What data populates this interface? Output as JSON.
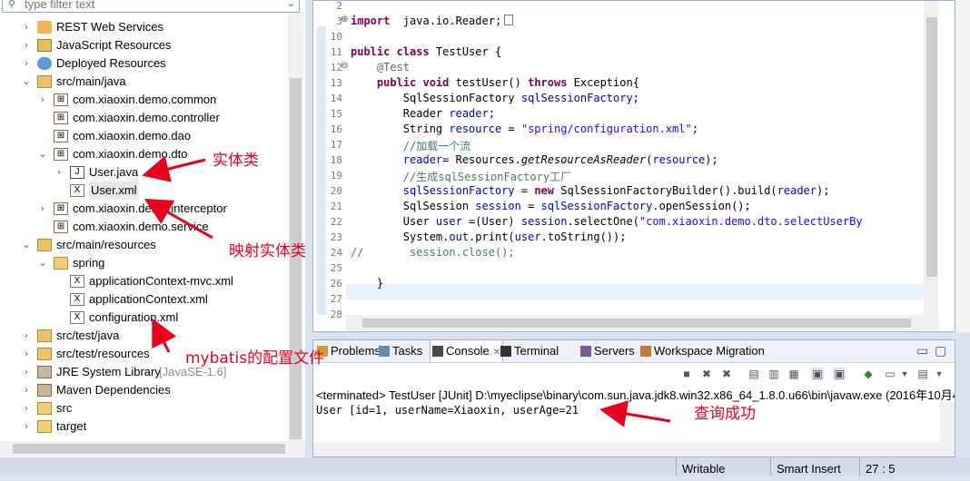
{
  "filter": {
    "placeholder": "type filter text"
  },
  "tree": [
    {
      "label": "REST Web Services",
      "indent": 0,
      "twisty": "›",
      "icon": "rest-services-icon"
    },
    {
      "label": "JavaScript Resources",
      "indent": 0,
      "twisty": "›",
      "icon": "js-resources-icon"
    },
    {
      "label": "Deployed Resources",
      "indent": 0,
      "twisty": "›",
      "icon": "deployed-resources-icon"
    },
    {
      "label": "src/main/java",
      "indent": 0,
      "twisty": "⌄",
      "icon": "source-folder-icon"
    },
    {
      "label": "com.xiaoxin.demo.common",
      "indent": 1,
      "twisty": "›",
      "icon": "package-icon"
    },
    {
      "label": "com.xiaoxin.demo.controller",
      "indent": 1,
      "twisty": "",
      "icon": "package-icon"
    },
    {
      "label": "com.xiaoxin.demo.dao",
      "indent": 1,
      "twisty": "",
      "icon": "package-icon"
    },
    {
      "label": "com.xiaoxin.demo.dto",
      "indent": 1,
      "twisty": "⌄",
      "icon": "package-icon"
    },
    {
      "label": "User.java",
      "indent": 2,
      "twisty": "›",
      "icon": "java-file-icon"
    },
    {
      "label": "User.xml",
      "indent": 2,
      "twisty": "",
      "icon": "xml-file-icon",
      "selected": true
    },
    {
      "label": "com.xiaoxin.demo.interceptor",
      "indent": 1,
      "twisty": "›",
      "icon": "package-icon"
    },
    {
      "label": "com.xiaoxin.demo.service",
      "indent": 1,
      "twisty": "",
      "icon": "package-icon"
    },
    {
      "label": "src/main/resources",
      "indent": 0,
      "twisty": "⌄",
      "icon": "source-folder-icon"
    },
    {
      "label": "spring",
      "indent": 1,
      "twisty": "⌄",
      "icon": "folder-icon"
    },
    {
      "label": "applicationContext-mvc.xml",
      "indent": 2,
      "twisty": "",
      "icon": "xml-file-icon"
    },
    {
      "label": "applicationContext.xml",
      "indent": 2,
      "twisty": "",
      "icon": "xml-file-icon"
    },
    {
      "label": "configuration.xml",
      "indent": 2,
      "twisty": "",
      "icon": "xml-file-icon"
    },
    {
      "label": "src/test/java",
      "indent": 0,
      "twisty": "›",
      "icon": "source-folder-icon"
    },
    {
      "label": "src/test/resources",
      "indent": 0,
      "twisty": "›",
      "icon": "source-folder-icon"
    },
    {
      "label": "JRE System Library",
      "suffix": "[JavaSE-1.6]",
      "indent": 0,
      "twisty": "›",
      "icon": "library-icon"
    },
    {
      "label": "Maven Dependencies",
      "indent": 0,
      "twisty": "›",
      "icon": "library-icon"
    },
    {
      "label": "src",
      "indent": 0,
      "twisty": "›",
      "icon": "folder-icon"
    },
    {
      "label": "target",
      "indent": 0,
      "twisty": "›",
      "icon": "folder-icon"
    }
  ],
  "editor": {
    "lines": [
      {
        "n": "2",
        "parts": []
      },
      {
        "n": "3",
        "fold": "⊕",
        "parts": [
          [
            "kw",
            "import"
          ],
          [
            "",
            "  java.io.Reader;"
          ],
          [
            "box",
            ""
          ]
        ]
      },
      {
        "n": "10",
        "parts": []
      },
      {
        "n": "11",
        "parts": [
          [
            "kw",
            "public class"
          ],
          [
            "",
            " TestUser {"
          ]
        ]
      },
      {
        "n": "12",
        "fold": "⊖",
        "parts": [
          [
            "ann",
            "    @Test"
          ]
        ]
      },
      {
        "n": "13",
        "parts": [
          [
            "",
            "    "
          ],
          [
            "kw",
            "public void"
          ],
          [
            "",
            " testUser() "
          ],
          [
            "kw",
            "throws"
          ],
          [
            "",
            " Exception{"
          ]
        ]
      },
      {
        "n": "14",
        "parts": [
          [
            "",
            "        SqlSessionFactory "
          ],
          [
            "fld",
            "sqlSessionFactory"
          ],
          [
            "",
            ";"
          ]
        ]
      },
      {
        "n": "15",
        "parts": [
          [
            "",
            "        Reader "
          ],
          [
            "fld",
            "reader"
          ],
          [
            "",
            ";"
          ]
        ]
      },
      {
        "n": "16",
        "parts": [
          [
            "",
            "        String "
          ],
          [
            "fld",
            "resource"
          ],
          [
            "",
            " = "
          ],
          [
            "str",
            "\"spring/configuration.xml\""
          ],
          [
            "",
            ";"
          ]
        ]
      },
      {
        "n": "17",
        "parts": [
          [
            "cm",
            "        //加载一个流"
          ]
        ]
      },
      {
        "n": "18",
        "parts": [
          [
            "",
            "        "
          ],
          [
            "fld",
            "reader"
          ],
          [
            "",
            "= Resources."
          ],
          [
            "it",
            "getResourceAsReader"
          ],
          [
            "",
            "("
          ],
          [
            "fld",
            "resource"
          ],
          [
            "",
            ");"
          ]
        ]
      },
      {
        "n": "19",
        "parts": [
          [
            "cm",
            "        //生成sqlSessionFactory工厂"
          ]
        ]
      },
      {
        "n": "20",
        "parts": [
          [
            "",
            "        "
          ],
          [
            "fld",
            "sqlSessionFactory"
          ],
          [
            "",
            " = "
          ],
          [
            "kw",
            "new"
          ],
          [
            "",
            " SqlSessionFactoryBuilder().build("
          ],
          [
            "fld",
            "reader"
          ],
          [
            "",
            ");"
          ]
        ]
      },
      {
        "n": "21",
        "parts": [
          [
            "",
            "        SqlSession "
          ],
          [
            "fld",
            "session"
          ],
          [
            "",
            " = "
          ],
          [
            "fld",
            "sqlSessionFactory"
          ],
          [
            "",
            ".openSession();"
          ]
        ]
      },
      {
        "n": "22",
        "parts": [
          [
            "",
            "        User "
          ],
          [
            "fld",
            "user"
          ],
          [
            "",
            " =(User) "
          ],
          [
            "fld",
            "session"
          ],
          [
            "",
            ".selectOne("
          ],
          [
            "str",
            "\"com.xiaoxin.demo.dto.selectUserBy"
          ]
        ]
      },
      {
        "n": "23",
        "parts": [
          [
            "",
            "        System."
          ],
          [
            "fld",
            "out"
          ],
          [
            "",
            ".print("
          ],
          [
            "fld",
            "user"
          ],
          [
            "",
            ".toString());"
          ]
        ]
      },
      {
        "n": "24",
        "parts": [
          [
            "cm",
            "//       session.close();"
          ]
        ]
      },
      {
        "n": "25",
        "parts": []
      },
      {
        "n": "26",
        "parts": [
          [
            "",
            "    }"
          ]
        ]
      },
      {
        "n": "27",
        "parts": []
      },
      {
        "n": "28",
        "parts": []
      }
    ]
  },
  "views": {
    "tabs": [
      {
        "label": "Problems",
        "icon": "problems-icon"
      },
      {
        "label": "Tasks",
        "icon": "tasks-icon"
      },
      {
        "label": "Console",
        "icon": "console-icon",
        "active": true,
        "close": "✕"
      },
      {
        "label": "Terminal",
        "icon": "terminal-icon"
      },
      {
        "label": "Servers",
        "icon": "servers-icon"
      },
      {
        "label": "Workspace Migration",
        "icon": "migration-icon"
      }
    ],
    "minimize_glyph": "▭",
    "maximize_glyph": "▢",
    "terminated_line": "<terminated> TestUser [JUnit] D:\\myeclipse\\binary\\com.sun.java.jdk8.win32.x86_64_1.8.0.u66\\bin\\javaw.exe (2016年10月4",
    "output_line": "User [id=1, userName=Xiaoxin, userAge=21"
  },
  "status": {
    "writable": "Writable",
    "insert": "Smart Insert",
    "position": "27 : 5"
  },
  "annotations": {
    "entity": "实体类",
    "mapping": "映射实体类",
    "config": "mybatis的配置文件",
    "success": "查询成功"
  },
  "colors": {
    "annotation": "#e8001f",
    "keyword": "#7f0055",
    "string": "#2a00ff",
    "comment": "#3f7f5f",
    "field": "#0000c0"
  }
}
